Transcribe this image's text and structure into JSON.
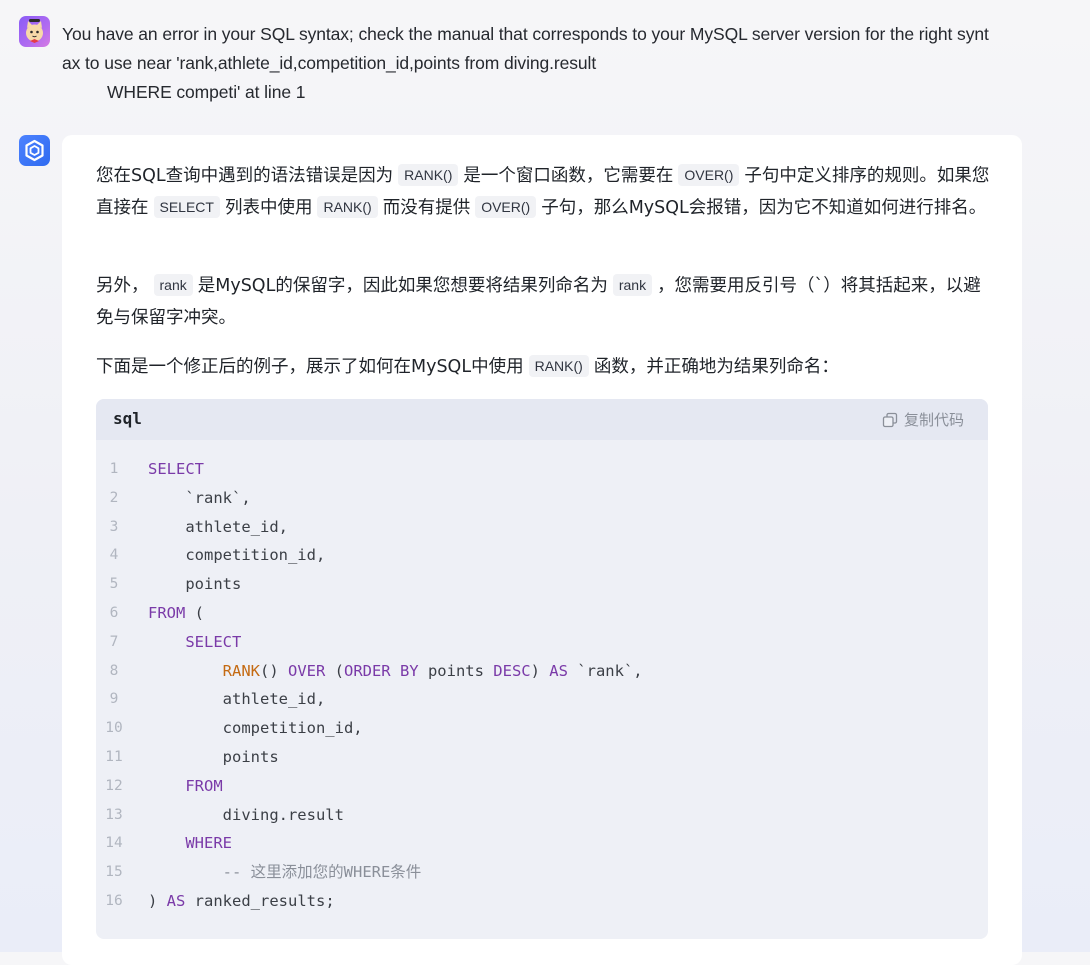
{
  "user_message": {
    "line1": "You have an error in your SQL syntax; check the manual that corresponds to your MySQL server version for the right synt",
    "line2": "ax to use near 'rank,athlete_id,competition_id,points from diving.result",
    "line3": "WHERE  competi' at line 1"
  },
  "assistant": {
    "p1": {
      "t1": "您在SQL查询中遇到的语法错误是因为",
      "c1": "RANK()",
      "t2": "是一个窗口函数，它需要在",
      "c2": "OVER()",
      "t3": "子句中定义排序的规则。如果您直接在",
      "c3": "SELECT",
      "t4": "列表中使用",
      "c4": "RANK()",
      "t5": "而没有提供",
      "c5": "OVER()",
      "t6": "子句，那么MySQL会报错，因为它不知道如何进行排名。"
    },
    "p2": {
      "t1": "另外，",
      "c1": "rank",
      "t2": "是MySQL的保留字，因此如果您想要将结果列命名为",
      "c2": "rank",
      "t3": "，您需要用反引号（`）将其括起来，以避免与保留字冲突。"
    },
    "p3": {
      "t1": "下面是一个修正后的例子，展示了如何在MySQL中使用",
      "c1": "RANK()",
      "t2": "函数，并正确地为结果列命名："
    },
    "code_block": {
      "language": "sql",
      "copy_label": "复制代码",
      "lines": [
        {
          "n": "1",
          "segs": [
            {
              "t": "SELECT",
              "c": "kw"
            }
          ]
        },
        {
          "n": "2",
          "segs": [
            {
              "t": "    `rank`,",
              "c": ""
            }
          ]
        },
        {
          "n": "3",
          "segs": [
            {
              "t": "    athlete_id,",
              "c": ""
            }
          ]
        },
        {
          "n": "4",
          "segs": [
            {
              "t": "    competition_id,",
              "c": ""
            }
          ]
        },
        {
          "n": "5",
          "segs": [
            {
              "t": "    points",
              "c": ""
            }
          ]
        },
        {
          "n": "6",
          "segs": [
            {
              "t": "FROM",
              "c": "kw"
            },
            {
              "t": " (",
              "c": ""
            }
          ]
        },
        {
          "n": "7",
          "segs": [
            {
              "t": "    ",
              "c": ""
            },
            {
              "t": "SELECT",
              "c": "kw"
            }
          ]
        },
        {
          "n": "8",
          "segs": [
            {
              "t": "        ",
              "c": ""
            },
            {
              "t": "RANK",
              "c": "fn"
            },
            {
              "t": "() ",
              "c": ""
            },
            {
              "t": "OVER",
              "c": "kw"
            },
            {
              "t": " (",
              "c": ""
            },
            {
              "t": "ORDER BY",
              "c": "kw"
            },
            {
              "t": " points ",
              "c": ""
            },
            {
              "t": "DESC",
              "c": "kw"
            },
            {
              "t": ") ",
              "c": ""
            },
            {
              "t": "AS",
              "c": "kw"
            },
            {
              "t": " `rank`,",
              "c": ""
            }
          ]
        },
        {
          "n": "9",
          "segs": [
            {
              "t": "        athlete_id,",
              "c": ""
            }
          ]
        },
        {
          "n": "10",
          "segs": [
            {
              "t": "        competition_id,",
              "c": ""
            }
          ]
        },
        {
          "n": "11",
          "segs": [
            {
              "t": "        points",
              "c": ""
            }
          ]
        },
        {
          "n": "12",
          "segs": [
            {
              "t": "    ",
              "c": ""
            },
            {
              "t": "FROM",
              "c": "kw"
            }
          ]
        },
        {
          "n": "13",
          "segs": [
            {
              "t": "        diving.result",
              "c": ""
            }
          ]
        },
        {
          "n": "14",
          "segs": [
            {
              "t": "    ",
              "c": ""
            },
            {
              "t": "WHERE",
              "c": "kw"
            }
          ]
        },
        {
          "n": "15",
          "segs": [
            {
              "t": "        -- 这里添加您的WHERE条件",
              "c": "cm"
            }
          ]
        },
        {
          "n": "16",
          "segs": [
            {
              "t": ") ",
              "c": ""
            },
            {
              "t": "AS",
              "c": "kw"
            },
            {
              "t": " ranked_results;",
              "c": ""
            }
          ]
        }
      ]
    }
  },
  "icons": {
    "user_avatar": "cat-avatar-icon",
    "bot_avatar": "assistant-logo-icon",
    "copy": "copy-icon"
  },
  "colors": {
    "keyword": "#7a3aa8",
    "function": "#c46a12",
    "comment": "#8a8f99",
    "bot_avatar": "#2f6bf0"
  }
}
